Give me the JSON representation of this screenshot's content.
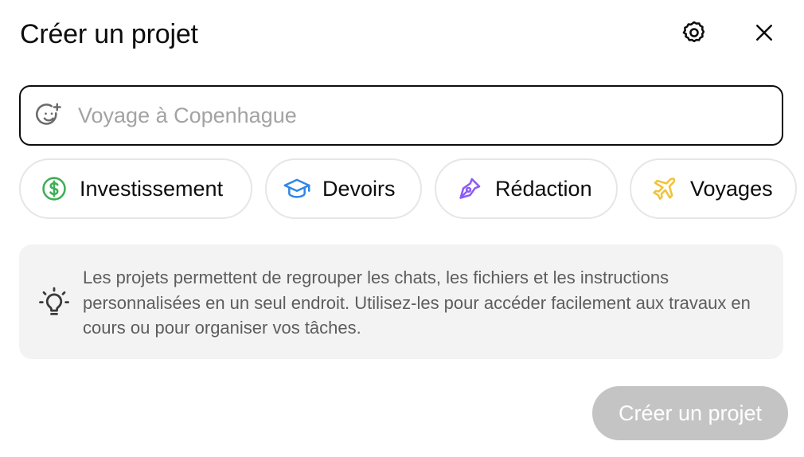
{
  "dialog": {
    "title": "Créer un projet"
  },
  "header": {
    "settings_icon": "gear-icon",
    "close_icon": "close-icon"
  },
  "name_field": {
    "icon": "emoji-add-icon",
    "value": "",
    "placeholder": "Voyage à Copenhague"
  },
  "chips": [
    {
      "label": "Investissement",
      "icon": "dollar-circle-icon",
      "color": "#3fae55"
    },
    {
      "label": "Devoirs",
      "icon": "graduation-cap-icon",
      "color": "#2f86e8"
    },
    {
      "label": "Rédaction",
      "icon": "pen-nib-icon",
      "color": "#8b5cf6"
    },
    {
      "label": "Voyages",
      "icon": "airplane-icon",
      "color": "#f0c33c"
    }
  ],
  "info": {
    "icon": "lightbulb-icon",
    "text": "Les projets permettent de regrouper les chats, les fichiers et les instructions personnalisées en un seul endroit. Utilisez-les pour accéder facilement aux travaux en cours ou pour organiser vos tâches."
  },
  "footer": {
    "create_label": "Créer un projet",
    "create_disabled": true
  },
  "colors": {
    "text": "#0d0d0d",
    "muted_text": "#5d5d5d",
    "placeholder": "#a3a3a3",
    "info_bg": "#f3f3f3",
    "chip_border": "#e6e6e6",
    "disabled_button": "#c4c4c4"
  }
}
